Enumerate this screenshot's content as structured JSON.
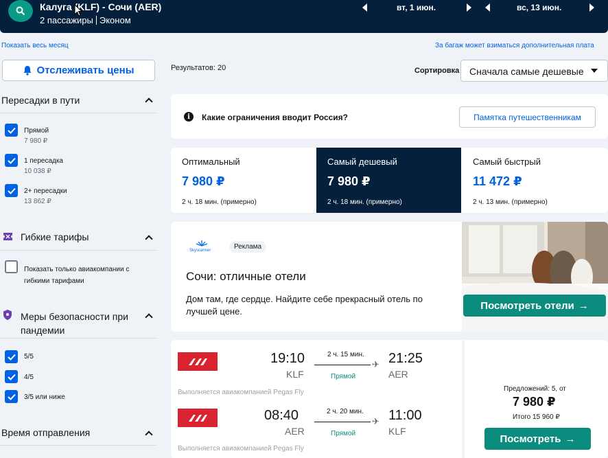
{
  "header": {
    "route": "Калуга (KLF) - Сочи (AER)",
    "passengers": "2 пассажиры",
    "cabin": "Эконом",
    "date_out": "вт, 1 июн.",
    "date_back": "вс, 13 июн."
  },
  "links": {
    "whole_month": "Показать весь месяц",
    "baggage_notice": "За багаж может взиматься дополнительная плата"
  },
  "sidebar": {
    "track_button": "Отслеживать цены",
    "stops": {
      "title": "Пересадки в пути",
      "options": [
        {
          "label": "Прямой",
          "price": "7 980 ₽",
          "checked": true
        },
        {
          "label": "1 пересадка",
          "price": "10 038 ₽",
          "checked": true
        },
        {
          "label": "2+ пересадки",
          "price": "13 862 ₽",
          "checked": true
        }
      ]
    },
    "flex": {
      "title": "Гибкие тарифы",
      "option": "Показать только авиакомпании с гибкими тарифами"
    },
    "safety": {
      "title": "Меры безопасности при пандемии",
      "options": [
        "5/5",
        "4/5",
        "3/5 или ниже"
      ]
    },
    "departure": {
      "title": "Время отправления"
    }
  },
  "main": {
    "results_count": "Результатов: 20",
    "sort_label": "Сортировка",
    "sort_value": "Сначала самые дешевые",
    "restrictions_text": "Какие ограничения вводит Россия?",
    "memo_button": "Памятка путешественникам",
    "tabs": [
      {
        "label": "Оптимальный",
        "price": "7 980 ₽",
        "duration": "2 ч. 18 мин. (примерно)"
      },
      {
        "label": "Самый дешевый",
        "price": "7 980 ₽",
        "duration": "2 ч. 18 мин. (примерно)"
      },
      {
        "label": "Самый быстрый",
        "price": "11 472 ₽",
        "duration": "2 ч. 13 мин. (примерно)"
      }
    ],
    "ad": {
      "brand": "Skyscanner",
      "badge": "Реклама",
      "title": "Сочи: отличные отели",
      "description": "Дом там, где сердце. Найдите себе прекрасный отель по лучшей цене.",
      "button": "Посмотреть отели"
    },
    "flight": {
      "legs": [
        {
          "dep_time": "19:10",
          "dep_code": "KLF",
          "duration": "2 ч. 15 мин.",
          "stops": "Прямой",
          "arr_time": "21:25",
          "arr_code": "AER",
          "operated": "Выполняется авиакомпанией Pegas Fly"
        },
        {
          "dep_time": "08:40",
          "dep_code": "AER",
          "duration": "2 ч. 20 мин.",
          "stops": "Прямой",
          "arr_time": "11:00",
          "arr_code": "KLF",
          "operated": "Выполняется авиакомпанией Pegas Fly"
        }
      ],
      "offers": "Предложений: 5, от",
      "price": "7 980 ₽",
      "total": "Итого 15 960 ₽",
      "button": "Посмотреть"
    }
  },
  "colors": {
    "navy": "#05203c",
    "blue": "#0062e3",
    "teal": "#0c8c7e",
    "airline_red": "#d9232e"
  }
}
